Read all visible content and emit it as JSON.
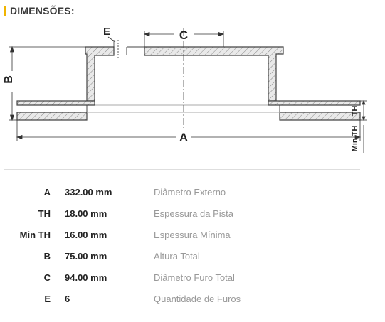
{
  "header": {
    "title": "DIMENSÕES:"
  },
  "diagram": {
    "label_A": "A",
    "label_B": "B",
    "label_C": "C",
    "label_E": "E",
    "label_TH": "TH",
    "label_MinTH": "Min TH"
  },
  "specs": [
    {
      "code": "A",
      "value": "332.00 mm",
      "desc": "Diâmetro Externo"
    },
    {
      "code": "TH",
      "value": "18.00 mm",
      "desc": "Espessura da Pista"
    },
    {
      "code": "Min TH",
      "value": "16.00 mm",
      "desc": "Espessura Mínima"
    },
    {
      "code": "B",
      "value": "75.00 mm",
      "desc": "Altura Total"
    },
    {
      "code": "C",
      "value": "94.00 mm",
      "desc": "Diâmetro Furo Total"
    },
    {
      "code": "E",
      "value": "6",
      "desc": "Quantidade de Furos"
    }
  ]
}
